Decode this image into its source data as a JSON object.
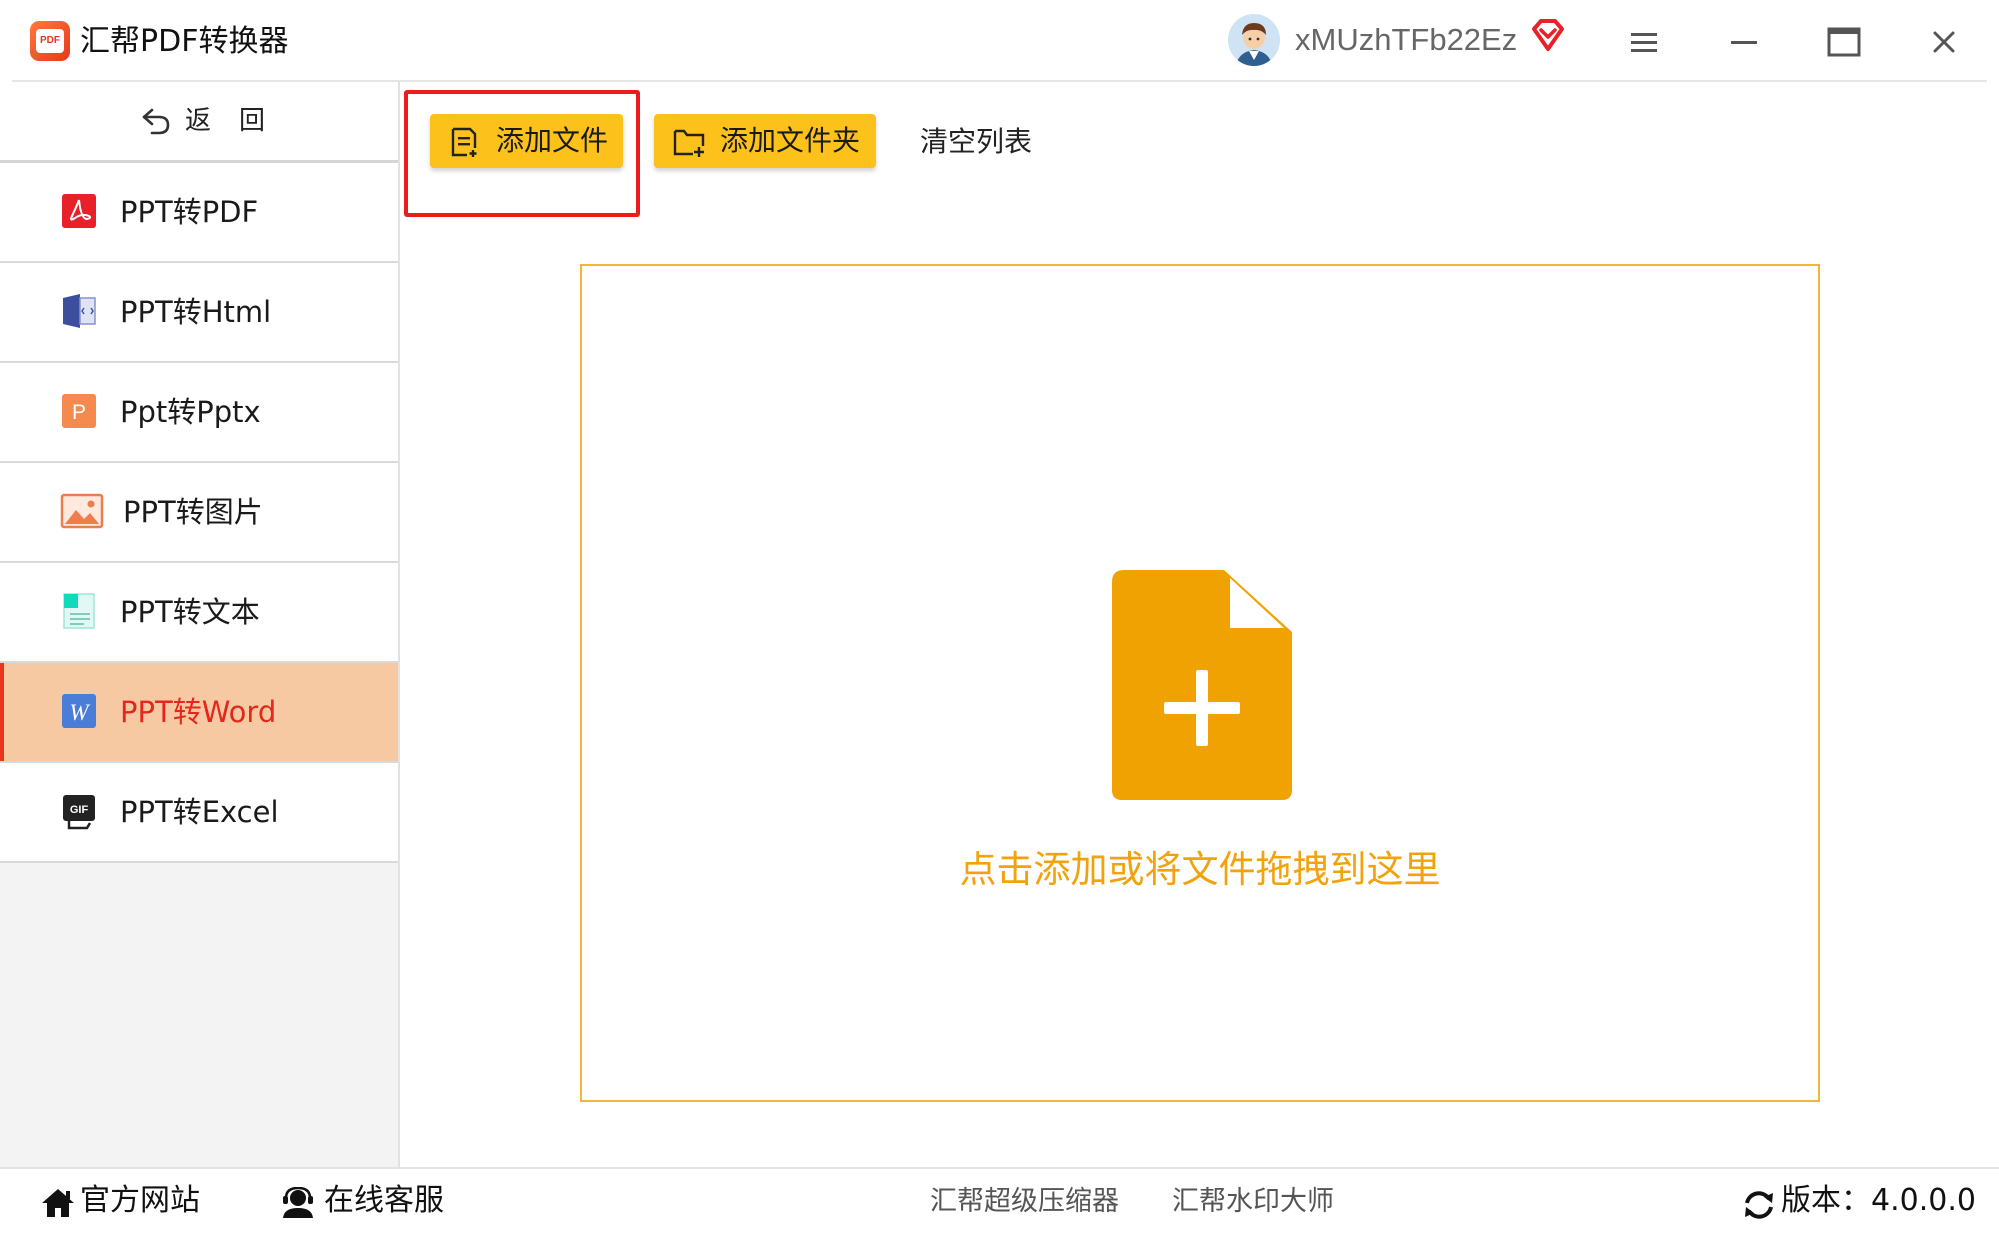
{
  "app": {
    "title": "汇帮PDF转换器",
    "logo_text": "PDF",
    "username": "xMUzhTFb22Ez"
  },
  "colors": {
    "accent_yellow": "#fcc21b",
    "active_item_bg": "#f7c9a2",
    "active_text": "#e4271b",
    "drop_icon": "#f0a202",
    "highlight_red": "#ef1b1b"
  },
  "sidebar": {
    "back_label": "返回",
    "items": [
      {
        "label": "PPT转PDF",
        "icon": "pdf-icon",
        "active": false
      },
      {
        "label": "PPT转Html",
        "icon": "html-icon",
        "active": false
      },
      {
        "label": "Ppt转Pptx",
        "icon": "pptx-icon",
        "active": false
      },
      {
        "label": "PPT转图片",
        "icon": "image-icon",
        "active": false
      },
      {
        "label": "PPT转文本",
        "icon": "text-icon",
        "active": false
      },
      {
        "label": "PPT转Word",
        "icon": "word-icon",
        "active": true
      },
      {
        "label": "PPT转Excel",
        "icon": "gif-icon",
        "active": false
      }
    ]
  },
  "toolbar": {
    "add_file": "添加文件",
    "add_folder": "添加文件夹",
    "clear_list": "清空列表"
  },
  "dropzone": {
    "text": "点击添加或将文件拖拽到这里"
  },
  "footer": {
    "website": "官方网站",
    "support": "在线客服",
    "link_compressor": "汇帮超级压缩器",
    "link_watermark": "汇帮水印大师",
    "version": "版本：4.0.0.0"
  }
}
